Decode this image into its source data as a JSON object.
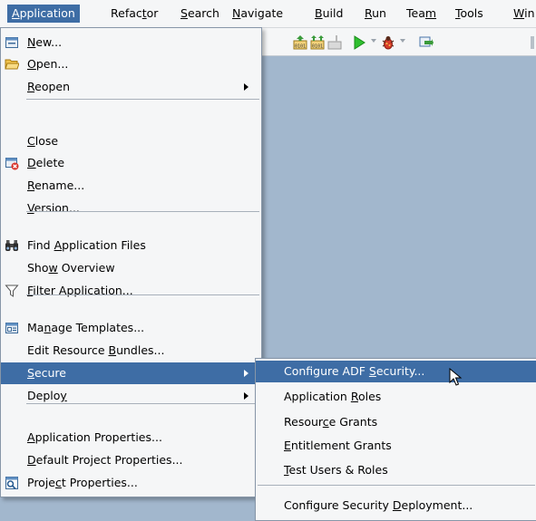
{
  "menubar": {
    "items": [
      {
        "label": "Application",
        "u": 0
      },
      {
        "label": "Refactor",
        "u": 5
      },
      {
        "label": "Search",
        "u": 0
      },
      {
        "label": "Navigate",
        "u": 0
      },
      {
        "label": "Build",
        "u": 0
      },
      {
        "label": "Run",
        "u": 0
      },
      {
        "label": "Team",
        "u": 3
      },
      {
        "label": "Tools",
        "u": 0
      },
      {
        "label": "Win",
        "u": 0
      }
    ]
  },
  "app_menu": {
    "items": [
      {
        "label": "New...",
        "u": 0,
        "icon": "new-app-icon"
      },
      {
        "label": "Open...",
        "u": 0,
        "icon": "folder-open-icon"
      },
      {
        "label": "Reopen",
        "u": 0,
        "submenu": true
      },
      {
        "label": "Close",
        "u": 0
      },
      {
        "label": "Delete",
        "u": 0,
        "icon": "delete-icon"
      },
      {
        "label": "Rename...",
        "u": 0
      },
      {
        "label": "Version...",
        "u": 0
      },
      {
        "label": "Find Application Files",
        "u": 5,
        "icon": "binoculars-icon"
      },
      {
        "label": "Show Overview",
        "u": 3
      },
      {
        "label": "Filter Application...",
        "u": 0,
        "icon": "filter-icon"
      },
      {
        "label": "Manage Templates...",
        "u": 2,
        "icon": "templates-icon"
      },
      {
        "label": "Edit Resource Bundles...",
        "u": 14
      },
      {
        "label": "Secure",
        "u": 0,
        "submenu": true,
        "selected": true
      },
      {
        "label": "Deploy",
        "u": 5,
        "submenu": true
      },
      {
        "label": "Application Properties...",
        "u": 0
      },
      {
        "label": "Default Project Properties...",
        "u": 0
      },
      {
        "label": "Project Properties...",
        "u": 5,
        "icon": "project-properties-icon"
      }
    ]
  },
  "secure_menu": {
    "items": [
      {
        "label": "Configure ADF Security...",
        "u": 14,
        "selected": true
      },
      {
        "label": "Application Roles",
        "u": 12
      },
      {
        "label": "Resource Grants",
        "u": 6
      },
      {
        "label": "Entitlement Grants",
        "u": 0
      },
      {
        "label": "Test Users & Roles",
        "u": 0
      },
      {
        "label": "Configure Security Deployment...",
        "u": 19
      }
    ]
  },
  "colors": {
    "selection": "#3e6da5",
    "workspace": "#a2b7cd",
    "menu_bg": "#f5f6f7"
  }
}
